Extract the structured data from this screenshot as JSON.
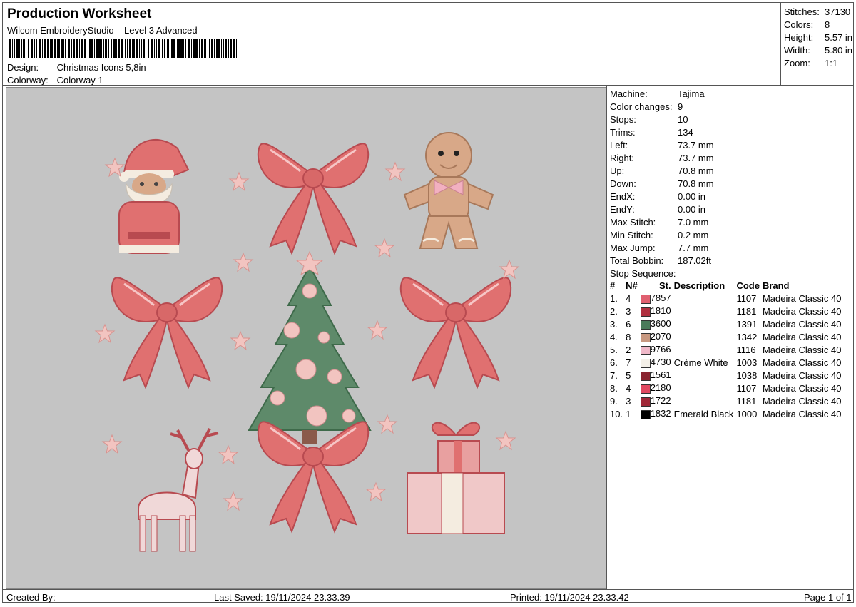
{
  "header": {
    "title": "Production Worksheet",
    "subtitle": "Wilcom EmbroideryStudio – Level 3 Advanced",
    "design_label": "Design:",
    "design_value": "Christmas Icons 5,8in",
    "colorway_label": "Colorway:",
    "colorway_value": "Colorway 1"
  },
  "summary": [
    {
      "label": "Stitches:",
      "value": "37130"
    },
    {
      "label": "Colors:",
      "value": "8"
    },
    {
      "label": "Height:",
      "value": "5.57 in"
    },
    {
      "label": "Width:",
      "value": "5.80 in"
    },
    {
      "label": "Zoom:",
      "value": "1:1"
    }
  ],
  "machine_info": [
    {
      "label": "Machine:",
      "value": "Tajima"
    },
    {
      "label": "Color changes:",
      "value": "9"
    },
    {
      "label": "Stops:",
      "value": "10"
    },
    {
      "label": "Trims:",
      "value": "134"
    },
    {
      "label": "Left:",
      "value": "73.7 mm"
    },
    {
      "label": "Right:",
      "value": "73.7 mm"
    },
    {
      "label": "Up:",
      "value": "70.8 mm"
    },
    {
      "label": "Down:",
      "value": "70.8 mm"
    },
    {
      "label": "EndX:",
      "value": "0.00 in"
    },
    {
      "label": "EndY:",
      "value": "0.00 in"
    },
    {
      "label": "Max Stitch:",
      "value": "7.0 mm"
    },
    {
      "label": "Min Stitch:",
      "value": "0.2 mm"
    },
    {
      "label": "Max Jump:",
      "value": "7.7 mm"
    },
    {
      "label": "Total Bobbin:",
      "value": "187.02ft"
    }
  ],
  "stop_sequence": {
    "title": "Stop Sequence:",
    "headers": {
      "num": "#",
      "n": "N#",
      "st": "St.",
      "desc": "Description",
      "code": "Code",
      "brand": "Brand"
    },
    "rows": [
      {
        "num": "1.",
        "n": "4",
        "color": "#e06070",
        "st": "7857",
        "desc": "",
        "code": "1107",
        "brand": "Madeira Classic 40"
      },
      {
        "num": "2.",
        "n": "3",
        "color": "#b03040",
        "st": "1810",
        "desc": "",
        "code": "1181",
        "brand": "Madeira Classic 40"
      },
      {
        "num": "3.",
        "n": "6",
        "color": "#4a7a5a",
        "st": "3600",
        "desc": "",
        "code": "1391",
        "brand": "Madeira Classic 40"
      },
      {
        "num": "4.",
        "n": "8",
        "color": "#c89880",
        "st": "2070",
        "desc": "",
        "code": "1342",
        "brand": "Madeira Classic 40"
      },
      {
        "num": "5.",
        "n": "2",
        "color": "#f0b8c8",
        "st": "9766",
        "desc": "",
        "code": "1116",
        "brand": "Madeira Classic 40"
      },
      {
        "num": "6.",
        "n": "7",
        "color": "#f4f0e8",
        "st": "4730",
        "desc": "Crème White",
        "code": "1003",
        "brand": "Madeira Classic 40"
      },
      {
        "num": "7.",
        "n": "5",
        "color": "#8a2430",
        "st": "1561",
        "desc": "",
        "code": "1038",
        "brand": "Madeira Classic 40"
      },
      {
        "num": "8.",
        "n": "4",
        "color": "#e04860",
        "st": "2180",
        "desc": "",
        "code": "1107",
        "brand": "Madeira Classic 40"
      },
      {
        "num": "9.",
        "n": "3",
        "color": "#a02838",
        "st": "1722",
        "desc": "",
        "code": "1181",
        "brand": "Madeira Classic 40"
      },
      {
        "num": "10.",
        "n": "1",
        "color": "#000000",
        "st": "1832",
        "desc": "Emerald Black",
        "code": "1000",
        "brand": "Madeira Classic 40"
      }
    ]
  },
  "footer": {
    "created_by": "Created By:",
    "last_saved": "Last Saved: 19/11/2024 23.33.39",
    "printed": "Printed: 19/11/2024 23.33.42",
    "page": "Page 1 of 1"
  },
  "colors": {
    "canvas_bg": "#c4c4c4",
    "bow": "#e07070",
    "bow_dark": "#b84a50",
    "star": "#f2c4c0",
    "tree": "#5e8a6a",
    "gingerbread": "#d8a888",
    "cream": "#f4ece0"
  }
}
